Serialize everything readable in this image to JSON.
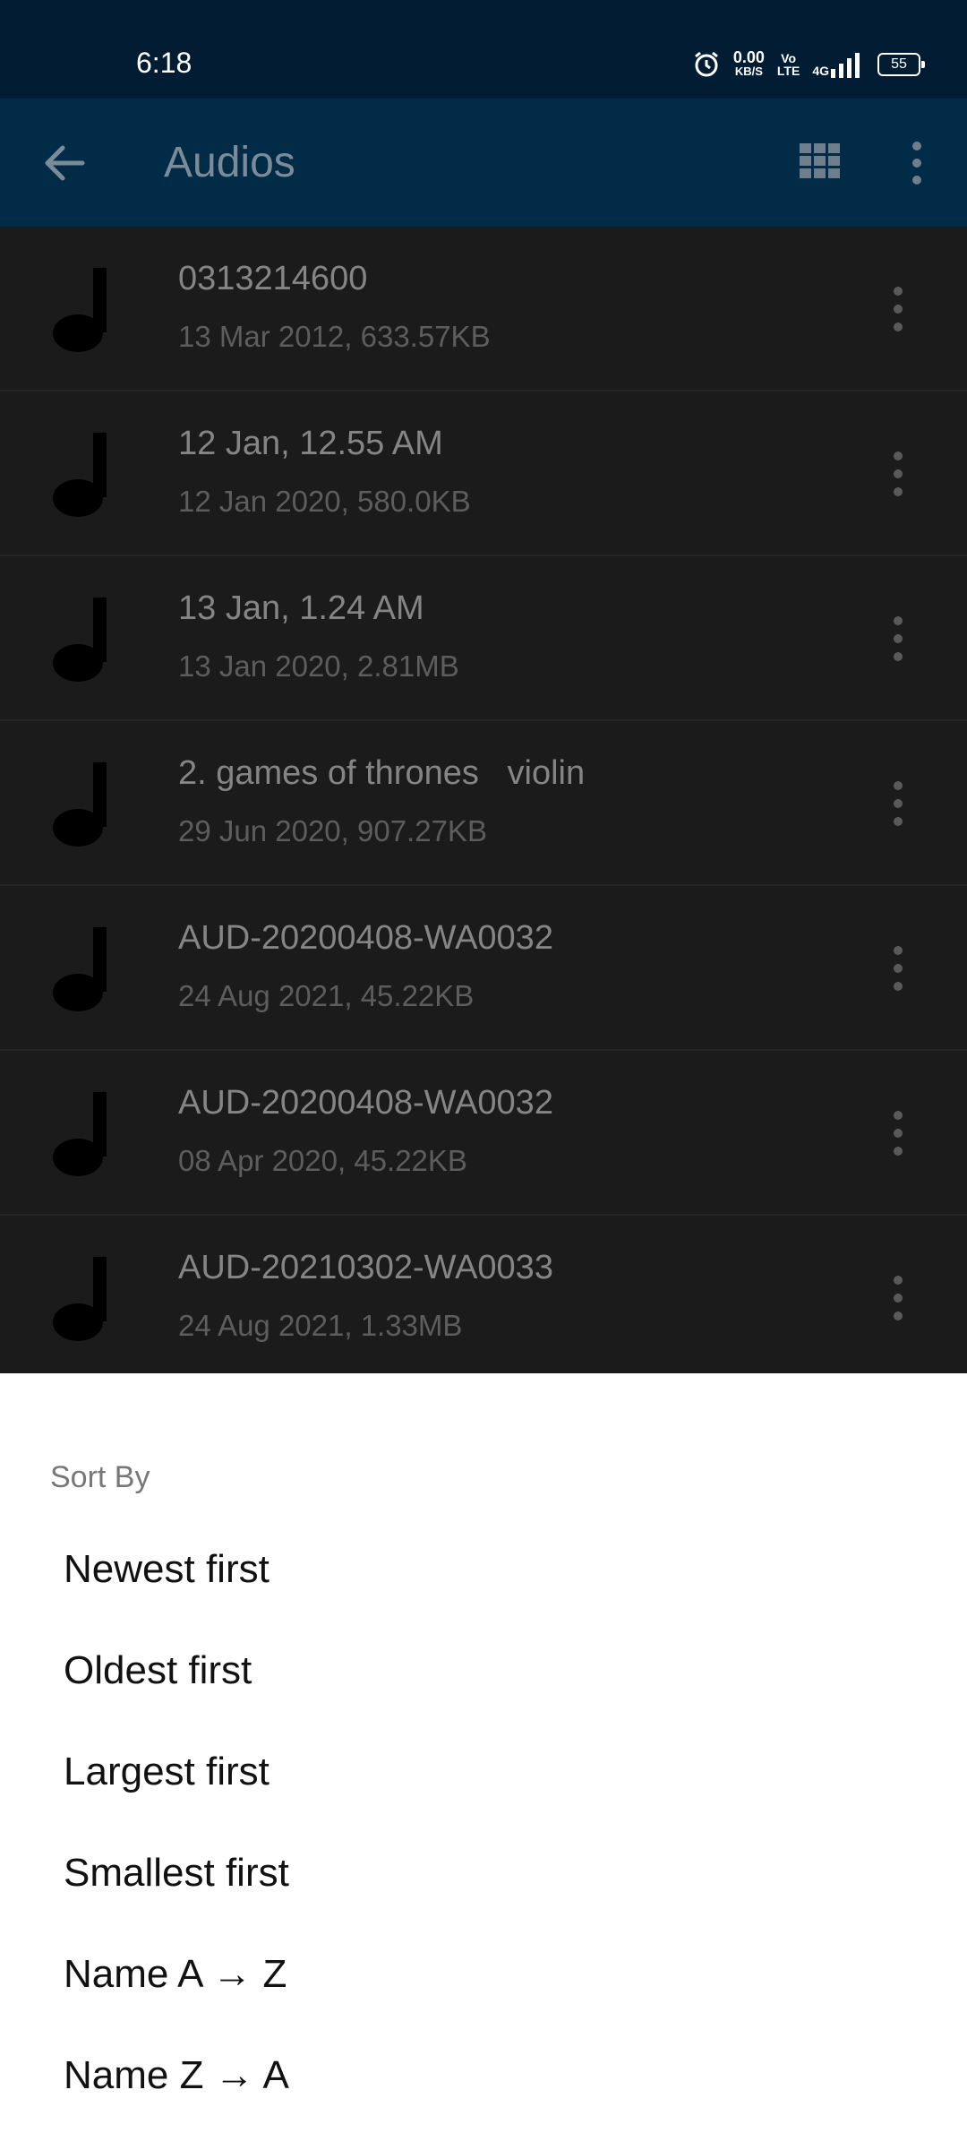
{
  "status_bar": {
    "time": "6:18",
    "net_speed_value": "0.00",
    "net_speed_unit": "KB/S",
    "volte_top": "Vo",
    "volte_bottom": "LTE",
    "network": "4G",
    "battery": "55"
  },
  "app_bar": {
    "title": "Audios",
    "background": "#022b47"
  },
  "files": [
    {
      "name": "0313214600",
      "meta": "13 Mar 2012, 633.57KB"
    },
    {
      "name": "12 Jan, 12.55 AM",
      "meta": "12 Jan 2020, 580.0KB"
    },
    {
      "name": "13 Jan, 1.24 AM",
      "meta": "13 Jan 2020, 2.81MB"
    },
    {
      "name": "2. games of thrones   violin",
      "meta": "29 Jun 2020, 907.27KB"
    },
    {
      "name": "AUD-20200408-WA0032",
      "meta": "24 Aug 2021, 45.22KB"
    },
    {
      "name": "AUD-20200408-WA0032",
      "meta": "08 Apr 2020, 45.22KB"
    },
    {
      "name": "AUD-20210302-WA0033",
      "meta": "24 Aug 2021, 1.33MB"
    }
  ],
  "sort_sheet": {
    "heading": "Sort By",
    "options": [
      "Newest first",
      "Oldest first",
      "Largest first",
      "Smallest first",
      "Name A → Z",
      "Name Z → A"
    ]
  }
}
